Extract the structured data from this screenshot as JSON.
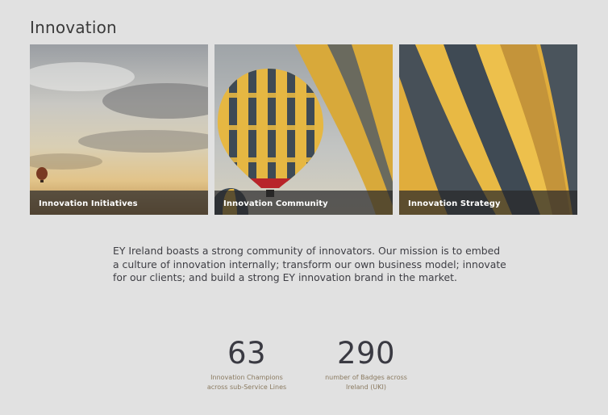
{
  "page": {
    "title": "Innovation"
  },
  "cards": [
    {
      "label": "Innovation Initiatives",
      "image": "sunset-sky-balloon-photo"
    },
    {
      "label": "Innovation Community",
      "image": "striped-hot-air-balloon-photo"
    },
    {
      "label": "Innovation Strategy",
      "image": "balloon-envelope-closeup-photo"
    }
  ],
  "intro": {
    "text": "EY Ireland boasts a strong community of innovators. Our mission is to embed a culture of innovation internally; transform our own business model; innovate for our clients; and build a strong EY innovation brand in the market."
  },
  "stats": [
    {
      "value": "63",
      "label_line1": "Innovation Champions",
      "label_line2": "across sub-Service Lines"
    },
    {
      "value": "290",
      "label_line1": "number of Badges across",
      "label_line2": "Ireland (UKI)"
    }
  ],
  "colors": {
    "background": "#e1e1e1",
    "balloon_yellow": "#e8b33a",
    "balloon_dark": "#3c4a52",
    "caption_bar": "#28282a"
  }
}
